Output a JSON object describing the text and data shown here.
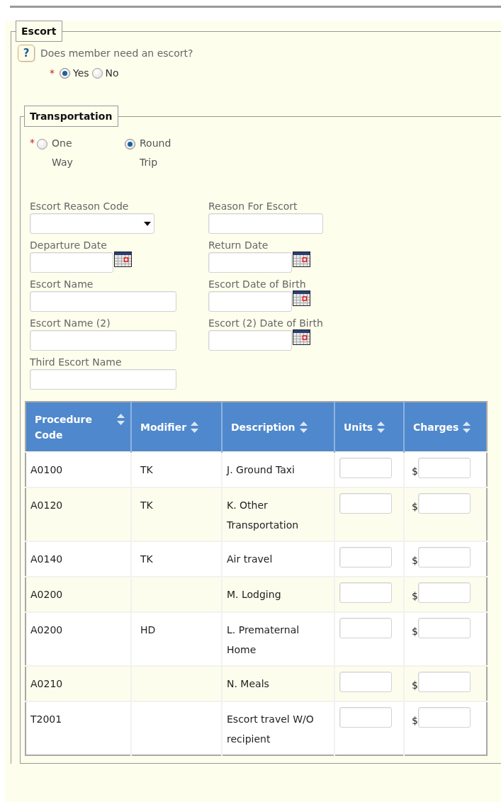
{
  "escort": {
    "legend": "Escort",
    "help_symbol": "?",
    "question": "Does member need an escort?",
    "required_mark": "*",
    "options": [
      {
        "label": "Yes",
        "selected": true
      },
      {
        "label": "No",
        "selected": false
      }
    ]
  },
  "transportation": {
    "legend": "Transportation",
    "required_mark": "*",
    "trip_options": [
      {
        "label": "One Way",
        "selected": false
      },
      {
        "label": "Round Trip",
        "selected": true
      }
    ],
    "fields": [
      {
        "label": "Escort Reason Code",
        "kind": "dropdown"
      },
      {
        "label": "Reason For Escort",
        "kind": "short"
      },
      {
        "label": "Departure Date",
        "kind": "date"
      },
      {
        "label": "Return Date",
        "kind": "date"
      },
      {
        "label": "Escort Name",
        "kind": "text"
      },
      {
        "label": "Escort Date of Birth",
        "kind": "date"
      },
      {
        "label": "Escort Name (2)",
        "kind": "text"
      },
      {
        "label": "Escort (2) Date of Birth",
        "kind": "date"
      },
      {
        "label": "Third Escort Name",
        "kind": "text"
      }
    ]
  },
  "table": {
    "columns": [
      "Procedure Code",
      "Modifier",
      "Description",
      "Units",
      "Charges"
    ],
    "rows": [
      {
        "code": "A0100",
        "modifier": "TK",
        "description": "J. Ground Taxi",
        "currency": "$"
      },
      {
        "code": "A0120",
        "modifier": "TK",
        "description": "K. Other Transportation",
        "currency": "$"
      },
      {
        "code": "A0140",
        "modifier": "TK",
        "description": "Air travel",
        "currency": "$"
      },
      {
        "code": "A0200",
        "description": "M. Lodging",
        "currency": "$"
      },
      {
        "code": "A0200",
        "modifier": "HD",
        "description": "L. Prematernal Home",
        "currency": "$"
      },
      {
        "code": "A0210",
        "description": "N. Meals",
        "currency": "$"
      },
      {
        "code": "T2001",
        "description": "Escort travel W/O recipient",
        "currency": "$"
      }
    ]
  }
}
